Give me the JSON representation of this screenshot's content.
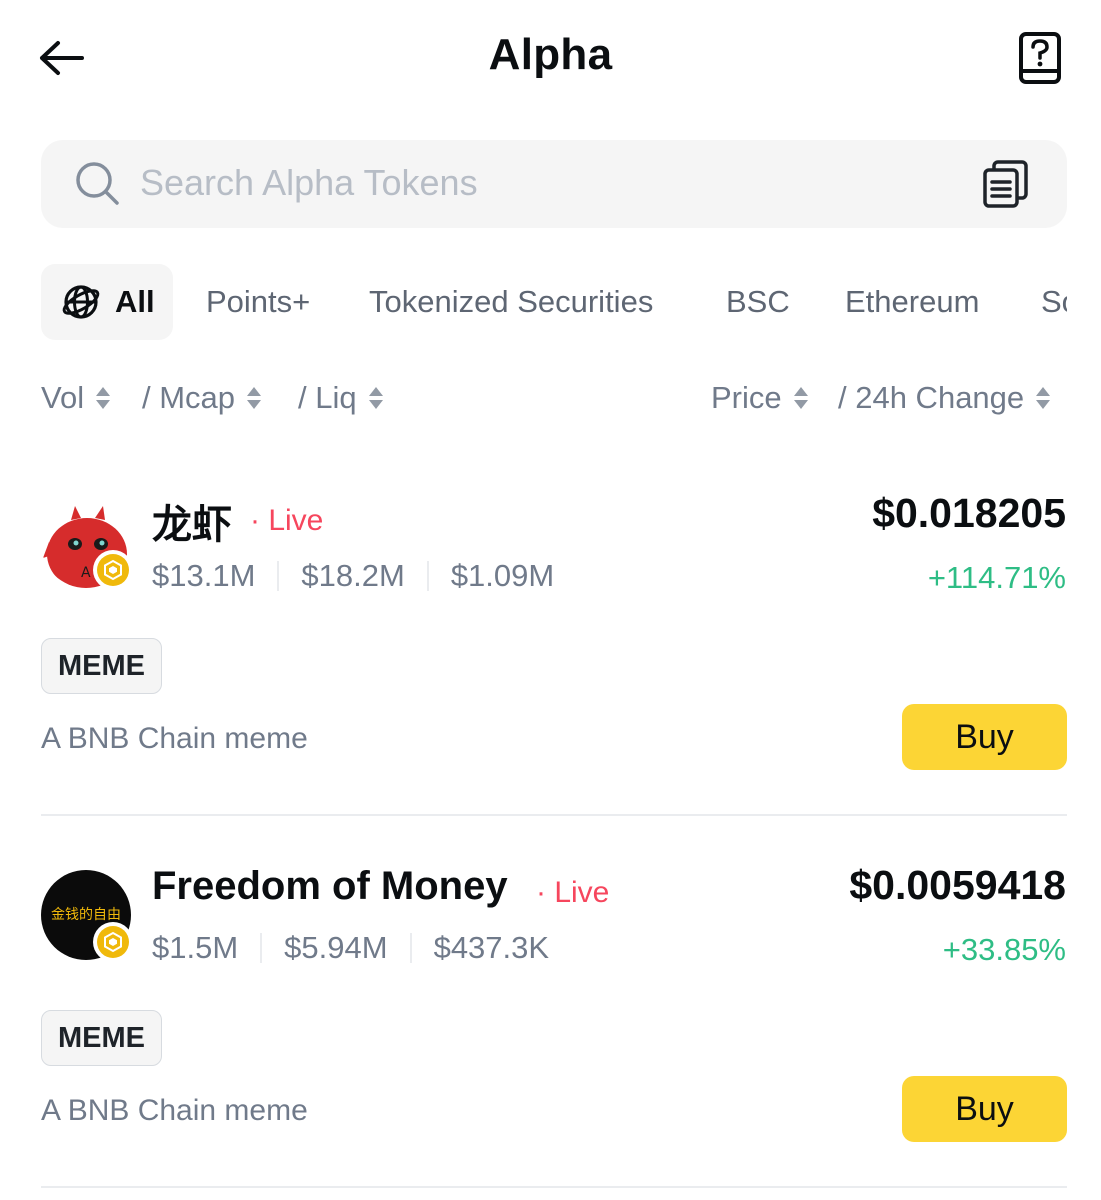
{
  "header": {
    "title": "Alpha",
    "back_icon": "arrow-left-icon",
    "help_icon": "help-book-icon"
  },
  "search": {
    "placeholder": "Search Alpha Tokens",
    "value": "",
    "search_icon": "search-icon",
    "list_icon": "list-icon"
  },
  "tabs": [
    {
      "label": "All",
      "active": true,
      "icon": "globe-icon"
    },
    {
      "label": "Points+",
      "active": false
    },
    {
      "label": "Tokenized Securities",
      "active": false
    },
    {
      "label": "BSC",
      "active": false
    },
    {
      "label": "Ethereum",
      "active": false
    },
    {
      "label": "So",
      "active": false
    }
  ],
  "sort": {
    "vol": "Vol",
    "mcap": "/ Mcap",
    "liq": "/ Liq",
    "price": "Price",
    "change": "/ 24h Change"
  },
  "tokens": [
    {
      "name": "龙虾",
      "live": "· Live",
      "vol": "$13.1M",
      "mcap": "$18.2M",
      "liq": "$1.09M",
      "price": "$0.018205",
      "change": "+114.71%",
      "tag": "MEME",
      "description": "A BNB Chain meme",
      "buy_label": "Buy",
      "avatar_letter": "A"
    },
    {
      "name": "Freedom of Money",
      "live": "· Live",
      "vol": "$1.5M",
      "mcap": "$5.94M",
      "liq": "$437.3K",
      "price": "$0.0059418",
      "change": "+33.85%",
      "tag": "MEME",
      "description": "A BNB Chain meme",
      "buy_label": "Buy",
      "avatar_text": "金钱的自由"
    }
  ],
  "colors": {
    "accent": "#fcd535",
    "positive": "#2ebd85",
    "live": "#f6465d",
    "muted": "#707a8a",
    "chain": "#f0b90b"
  }
}
